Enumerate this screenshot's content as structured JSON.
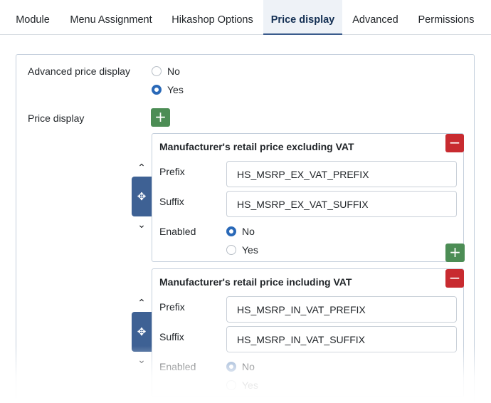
{
  "tabs": [
    {
      "label": "Module",
      "active": false
    },
    {
      "label": "Menu Assignment",
      "active": false
    },
    {
      "label": "Hikashop Options",
      "active": false
    },
    {
      "label": "Price display",
      "active": true
    },
    {
      "label": "Advanced",
      "active": false
    },
    {
      "label": "Permissions",
      "active": false
    }
  ],
  "advanced_price_display": {
    "label": "Advanced price display",
    "options": [
      "No",
      "Yes"
    ],
    "selected": "Yes"
  },
  "price_display": {
    "label": "Price display",
    "add_icon": "plus-icon",
    "remove_icon": "minus-icon",
    "move_icon": "arrows-move-icon",
    "items": [
      {
        "title": "Manufacturer's retail price excluding VAT",
        "prefix_label": "Prefix",
        "prefix_value": "HS_MSRP_EX_VAT_PREFIX",
        "suffix_label": "Suffix",
        "suffix_value": "HS_MSRP_EX_VAT_SUFFIX",
        "enabled_label": "Enabled",
        "enabled_options": [
          "No",
          "Yes"
        ],
        "enabled_selected": "No"
      },
      {
        "title": "Manufacturer's retail price including VAT",
        "prefix_label": "Prefix",
        "prefix_value": "HS_MSRP_IN_VAT_PREFIX",
        "suffix_label": "Suffix",
        "suffix_value": "HS_MSRP_IN_VAT_SUFFIX",
        "enabled_label": "Enabled",
        "enabled_options": [
          "No",
          "Yes"
        ],
        "enabled_selected": "No"
      }
    ]
  },
  "colors": {
    "accent": "#2a69b8",
    "add_button": "#4c8d55",
    "remove_button": "#c82b30",
    "drag_handle": "#3e6194",
    "active_tab_bg": "#eef2f7"
  }
}
